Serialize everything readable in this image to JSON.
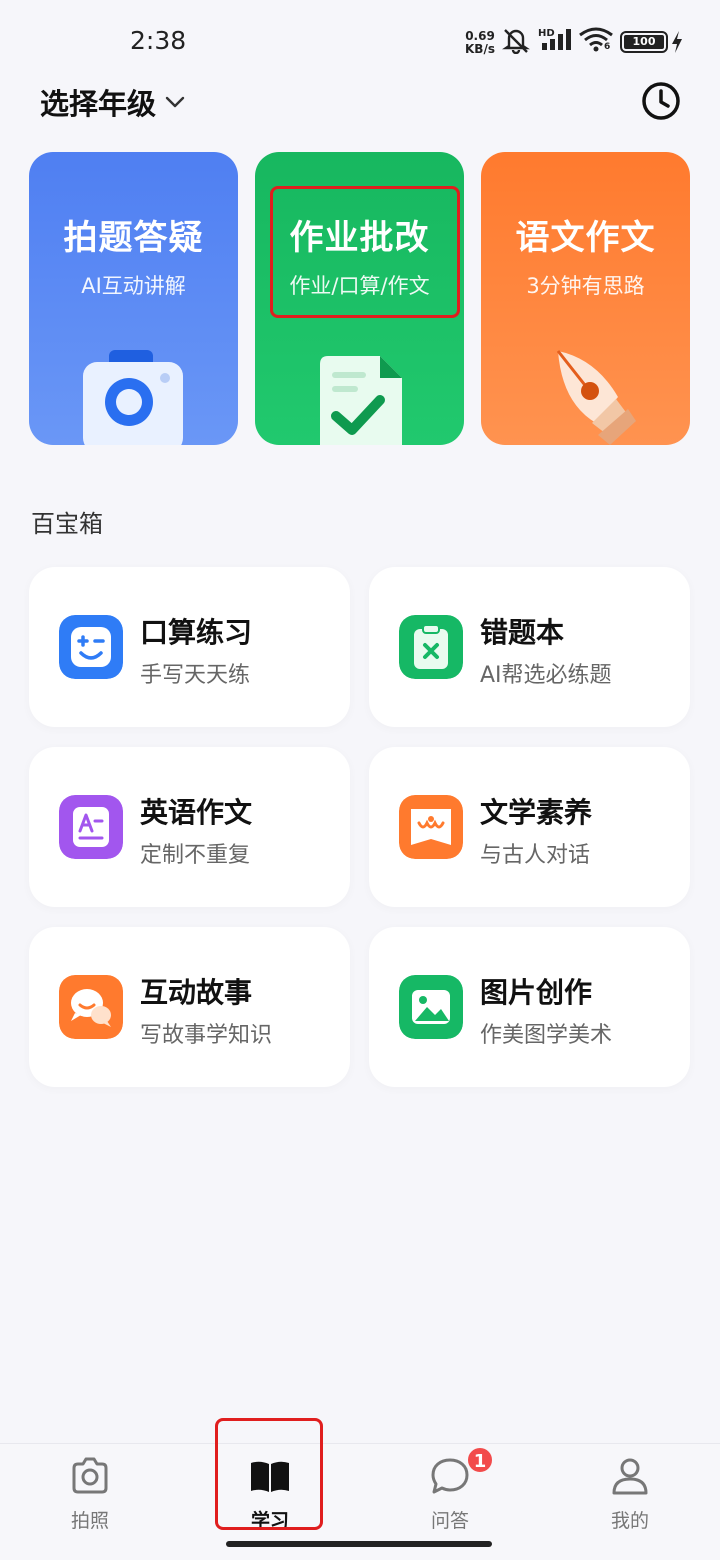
{
  "status_bar": {
    "time": "2:38",
    "net_speed_value": "0.69",
    "net_speed_unit": "KB/s",
    "signal_label": "HD",
    "wifi_label": "6",
    "battery_level": "100"
  },
  "header": {
    "grade_select_label": "选择年级",
    "history_icon": "clock-icon"
  },
  "feature_cards": [
    {
      "title": "拍题答疑",
      "subtitle": "AI互动讲解",
      "icon": "camera-icon",
      "color": "#5585f3"
    },
    {
      "title": "作业批改",
      "subtitle": "作业/口算/作文",
      "icon": "document-check-icon",
      "color": "#1bbf65"
    },
    {
      "title": "语文作文",
      "subtitle": "3分钟有思路",
      "icon": "pen-nib-icon",
      "color": "#ff8440"
    }
  ],
  "toolbox": {
    "title": "百宝箱",
    "items": [
      {
        "name": "口算练习",
        "desc": "手写天天练",
        "icon": "math-face-icon",
        "color": "#2f7cf6"
      },
      {
        "name": "错题本",
        "desc": "AI帮选必练题",
        "icon": "clipboard-x-icon",
        "color": "#16b865"
      },
      {
        "name": "英语作文",
        "desc": "定制不重复",
        "icon": "english-doc-icon",
        "color": "#a256ee"
      },
      {
        "name": "文学素养",
        "desc": "与古人对话",
        "icon": "book-scroll-icon",
        "color": "#ff7a2e"
      },
      {
        "name": "互动故事",
        "desc": "写故事学知识",
        "icon": "chat-bubbles-icon",
        "color": "#ff7a2e"
      },
      {
        "name": "图片创作",
        "desc": "作美图学美术",
        "icon": "image-icon",
        "color": "#16b865"
      }
    ]
  },
  "bottom_nav": {
    "items": [
      {
        "label": "拍照",
        "icon": "camera-outline-icon"
      },
      {
        "label": "学习",
        "icon": "open-book-icon",
        "active": true
      },
      {
        "label": "问答",
        "icon": "chat-outline-icon",
        "badge": "1"
      },
      {
        "label": "我的",
        "icon": "person-outline-icon"
      }
    ]
  }
}
